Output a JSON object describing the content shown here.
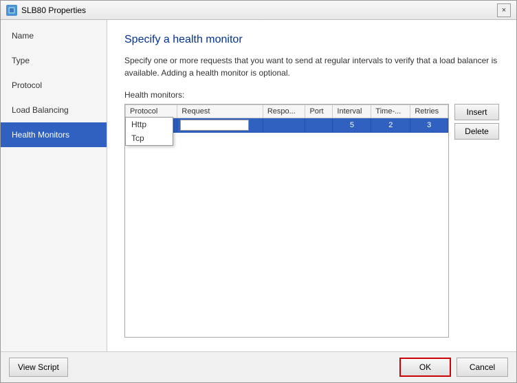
{
  "window": {
    "title": "SLB80 Properties",
    "close_label": "×"
  },
  "sidebar": {
    "items": [
      {
        "id": "name",
        "label": "Name"
      },
      {
        "id": "type",
        "label": "Type"
      },
      {
        "id": "protocol",
        "label": "Protocol"
      },
      {
        "id": "load-balancing",
        "label": "Load Balancing"
      },
      {
        "id": "health-monitors",
        "label": "Health Monitors"
      }
    ]
  },
  "main": {
    "title": "Specify a health monitor",
    "description": "Specify one or more requests that you want to send at regular intervals to verify that a load balancer is available. Adding a health monitor is optional.",
    "section_label": "Health monitors:",
    "table": {
      "columns": [
        {
          "id": "protocol",
          "label": "Protocol"
        },
        {
          "id": "request",
          "label": "Request"
        },
        {
          "id": "response",
          "label": "Respo..."
        },
        {
          "id": "port",
          "label": "Port"
        },
        {
          "id": "interval",
          "label": "Interval"
        },
        {
          "id": "timeout",
          "label": "Time-..."
        },
        {
          "id": "retries",
          "label": "Retries"
        }
      ],
      "rows": [
        {
          "protocol_value": "",
          "request_value": "",
          "response": "",
          "port": "",
          "interval": "5",
          "timeout": "2",
          "retries": "3"
        }
      ]
    },
    "dropdown_options": [
      "Http",
      "Tcp"
    ],
    "buttons": {
      "insert": "Insert",
      "delete": "Delete"
    }
  },
  "bottom": {
    "view_script_label": "View Script",
    "ok_label": "OK",
    "cancel_label": "Cancel"
  }
}
